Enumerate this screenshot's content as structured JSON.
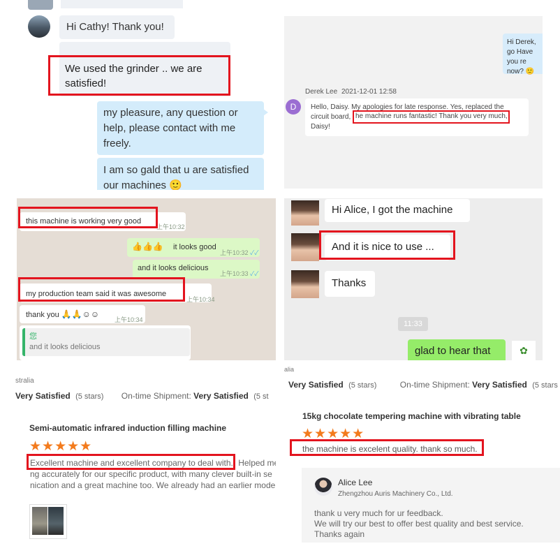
{
  "panel1": {
    "msg1": "Hi Cathy! Thank you!",
    "msg2": "We used the grinder .. we are satisfied!",
    "msg3": "my pleasure, any question or help, please contact with me freely.",
    "msg4": "I am so gald that u are satisfied our machines",
    "msg4_emoji": "🙂"
  },
  "panel2": {
    "top_bubble": "Hi Derek, go Have you re now?",
    "top_emoji": "🙂",
    "avatar_letter": "D",
    "sender": "Derek Lee",
    "timestamp": "2021-12-01 12:58",
    "message_before": "Hello, Daisy. My apologies for late response. Yes, replaced the circuit board,",
    "message_highlight": "he machine runs fantastic! Thank you very much,",
    "message_after": "Daisy!"
  },
  "panel3": {
    "msg1": "this machine is working very good",
    "msg1_time": "上午10:32",
    "msg2": "it looks good",
    "msg2_emoji": "👍👍👍",
    "msg2_time": "上午10:32",
    "msg3": "and it looks delicious",
    "msg3_time": "上午10:33",
    "msg4": "my production team said it was awesome",
    "msg4_time": "上午10:34",
    "msg5": "thank you",
    "msg5_emoji": "🙏🙏☺☺",
    "msg5_time": "上午10:34",
    "reply_author": "您",
    "reply_text": "and it looks delicious"
  },
  "panel4": {
    "msg1": "Hi Alice, I got the machine",
    "msg2": "And it is nice to use ...",
    "msg3": "Thanks",
    "time_chip": "11:33",
    "msg4": "glad to hear that",
    "msg4_icon": "sprout-icon"
  },
  "panel5": {
    "country": "stralia",
    "rating_label": "Very Satisfied",
    "rating_stars": "(5 stars)",
    "shipment_label": "On-time Shipment:",
    "shipment_value": "Very Satisfied",
    "shipment_stars": "(5 st",
    "product": "Semi-automatic infrared induction filling machine",
    "stars": "★★★★★",
    "review_highlight": "Excellent machine and excellent company to deal with.",
    "review_rest": "Helped me",
    "review_line2": "ng accurately for our specific product, with many clever built-in se",
    "review_line3": "nication and a great machine too. We already had an earlier mode"
  },
  "panel6": {
    "country": "alia",
    "rating_label": "Very Satisfied",
    "rating_stars": "(5 stars)",
    "shipment_label": "On-time Shipment:",
    "shipment_value": "Very Satisfied",
    "shipment_stars": "(5 stars",
    "product": "15kg chocolate tempering machine with vibrating table",
    "stars": "★★★★★",
    "review": "the machine is excelent quality. thank so much.",
    "reply_name": "Alice Lee",
    "reply_company": "Zhengzhou Auris Machinery Co., Ltd.",
    "reply_line1": "thank u very much for ur feedback.",
    "reply_line2": "We will try our best to offer best quality and best service.",
    "reply_line3": "Thanks again"
  },
  "colors": {
    "highlight_red": "#e3141e",
    "wechat_blue_bubble": "#d4ecfb",
    "whatsapp_green_bubble": "#dcf8c6",
    "wechat_green_bubble": "#95ec69",
    "star_orange": "#f37b1d"
  }
}
